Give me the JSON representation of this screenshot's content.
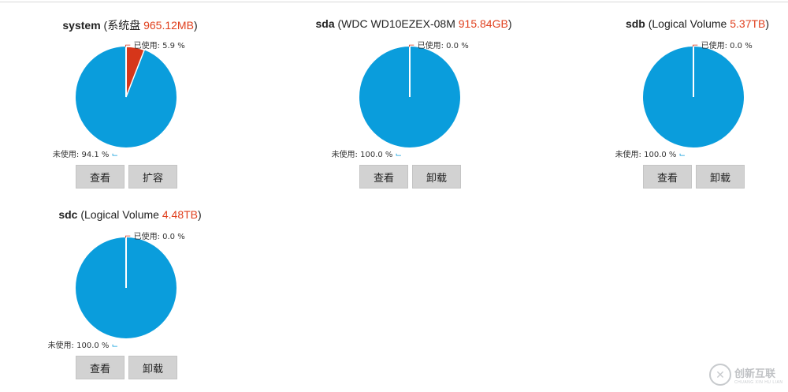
{
  "disks": [
    {
      "name": "system",
      "desc_prefix": " (系统盘 ",
      "size": "965.12MB",
      "desc_suffix": ")",
      "used_label": "已使用: 5.9 %",
      "unused_label": "未使用: 94.1 %",
      "used_percent": 5.9,
      "button1": "查看",
      "button2": "扩容"
    },
    {
      "name": "sda",
      "desc_prefix": " (WDC WD10EZEX-08M ",
      "size": "915.84GB",
      "desc_suffix": ")",
      "used_label": "已使用: 0.0 %",
      "unused_label": "未使用: 100.0 %",
      "used_percent": 0.0,
      "button1": "查看",
      "button2": "卸载"
    },
    {
      "name": "sdb",
      "desc_prefix": " (Logical Volume ",
      "size": "5.37TB",
      "desc_suffix": ")",
      "used_label": "已使用: 0.0 %",
      "unused_label": "未使用: 100.0 %",
      "used_percent": 0.0,
      "button1": "查看",
      "button2": "卸载"
    },
    {
      "name": "sdc",
      "desc_prefix": " (Logical Volume ",
      "size": "4.48TB",
      "desc_suffix": ")",
      "used_label": "已使用: 0.0 %",
      "unused_label": "未使用: 100.0 %",
      "used_percent": 0.0,
      "button1": "查看",
      "button2": "卸载"
    }
  ],
  "colors": {
    "used": "#d6361a",
    "unused": "#0a9ddc",
    "size_text": "#e0401e"
  },
  "watermark": {
    "main": "创新互联",
    "sub": "CHUANG XIN HU LIAN"
  }
}
